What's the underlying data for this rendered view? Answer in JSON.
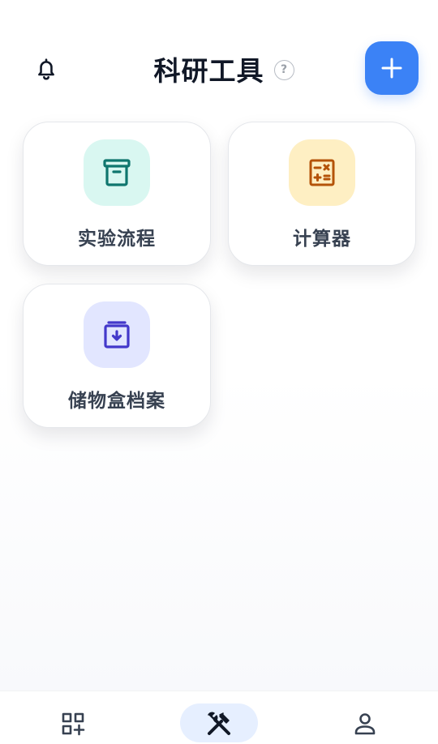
{
  "header": {
    "title": "科研工具",
    "help_symbol": "?",
    "bell_icon": "bell-icon",
    "add_icon": "plus-icon",
    "accent_color": "#3b82f6"
  },
  "tools": [
    {
      "label": "实验流程",
      "icon": "archive-box-icon",
      "icon_color": "#0f766e",
      "tile_color": "#d9f7f1"
    },
    {
      "label": "计算器",
      "icon": "calculator-icon",
      "icon_color": "#b45309",
      "tile_color": "#feefc3"
    },
    {
      "label": "储物盒档案",
      "icon": "archive-download-icon",
      "icon_color": "#4338ca",
      "tile_color": "#e2e6ff"
    }
  ],
  "bottom_nav": {
    "items": [
      {
        "icon": "grid-add-icon",
        "active": false
      },
      {
        "icon": "tools-icon",
        "active": true
      },
      {
        "icon": "user-icon",
        "active": false
      }
    ],
    "active_bg": "#e6efff"
  }
}
